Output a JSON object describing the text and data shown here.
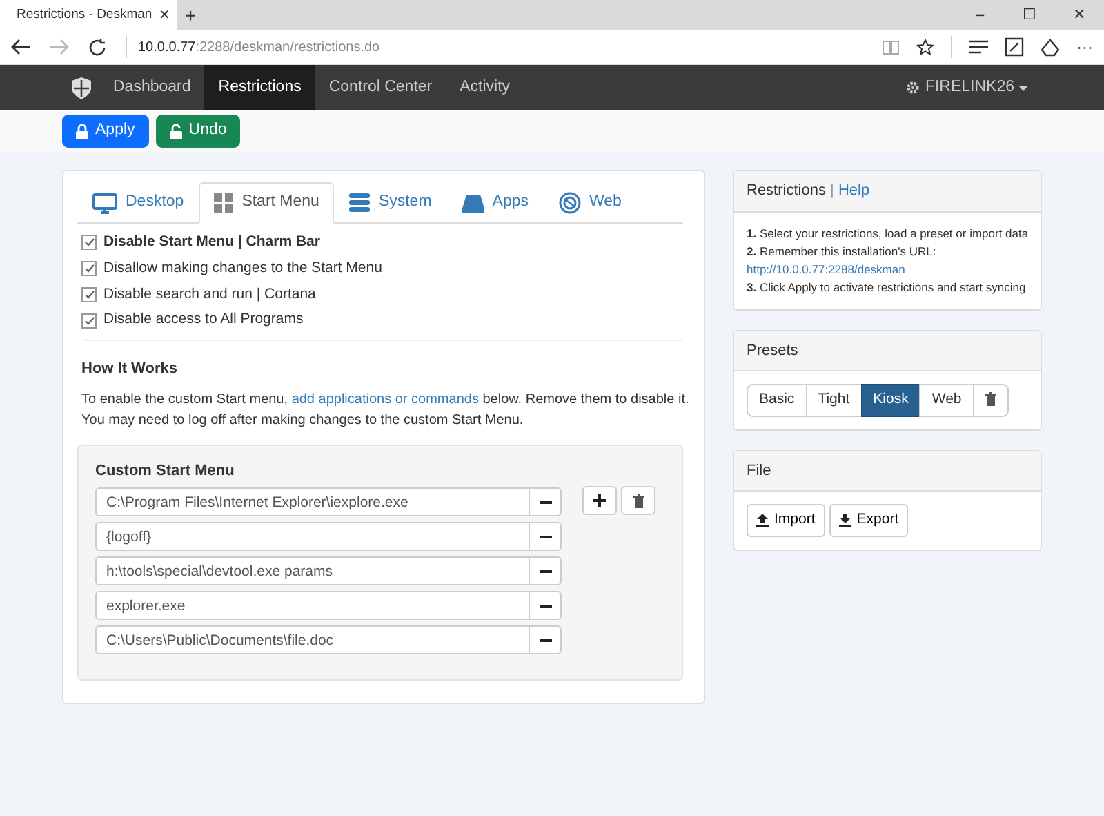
{
  "browser": {
    "tab_title": "Restrictions - Deskman",
    "tab_close": "✕",
    "new_tab": "+",
    "url_host": "10.0.0.77",
    "url_path": ":2288/deskman/restrictions.do",
    "window_controls": [
      "–",
      "☐",
      "✕"
    ],
    "more": "···"
  },
  "navbar": {
    "items": [
      {
        "label": "Dashboard",
        "selected": false
      },
      {
        "label": "Restrictions",
        "selected": true
      },
      {
        "label": "Control Center",
        "selected": false
      },
      {
        "label": "Activity",
        "selected": false
      }
    ],
    "user": "FIRELINK26"
  },
  "toolbar": [
    {
      "label": "Apply",
      "kind": "primary"
    },
    {
      "label": "Undo",
      "kind": "success"
    }
  ],
  "tabs": [
    {
      "label": "Desktop",
      "selected": false
    },
    {
      "label": "Start Menu",
      "selected": true
    },
    {
      "label": "System",
      "selected": false
    },
    {
      "label": "Apps",
      "selected": false
    },
    {
      "label": "Web",
      "selected": false
    }
  ],
  "options": [
    {
      "label": "Disable Start Menu | Charm Bar",
      "checked": true,
      "strong": true
    },
    {
      "label": "Disallow making changes to the Start Menu",
      "checked": true,
      "strong": false
    },
    {
      "label": "Disable search and run | Cortana",
      "checked": true,
      "strong": false
    },
    {
      "label": "Disable access to All Programs",
      "checked": true,
      "strong": false
    }
  ],
  "how_it_works": {
    "title": "How It Works",
    "before": "To enable the custom Start menu, ",
    "link": "add applications or commands",
    "after": " below. Remove them to disable it.",
    "note": "You may need to log off after making changes to the custom Start Menu."
  },
  "custom_menu": {
    "title": "Custom Start Menu",
    "entries": [
      "C:\\Program Files\\Internet Explorer\\iexplore.exe",
      "{logoff}",
      "h:\\tools\\special\\devtool.exe params",
      "explorer.exe",
      "C:\\Users\\Public\\Documents\\file.doc"
    ]
  },
  "restrictions_panel": {
    "title": "Restrictions",
    "separator": "|",
    "help": "Help",
    "steps": [
      {
        "text": "**1.** Select your restrictions, load a preset or import data"
      },
      {
        "text": "**2.** Remember this installation's URL:",
        "link": "http://10.0.0.77:2288/deskman"
      },
      {
        "text": "**3.** Click Apply to activate restrictions and start syncing"
      }
    ]
  },
  "presets_panel": {
    "title": "Presets",
    "presets": [
      {
        "label": "Basic",
        "selected": false
      },
      {
        "label": "Tight",
        "selected": false
      },
      {
        "label": "Kiosk",
        "selected": true
      },
      {
        "label": "Web",
        "selected": false
      }
    ]
  },
  "file_panel": {
    "title": "File",
    "buttons": [
      {
        "label": "Import",
        "kind": "upload"
      },
      {
        "label": "Export",
        "kind": "download"
      }
    ]
  }
}
